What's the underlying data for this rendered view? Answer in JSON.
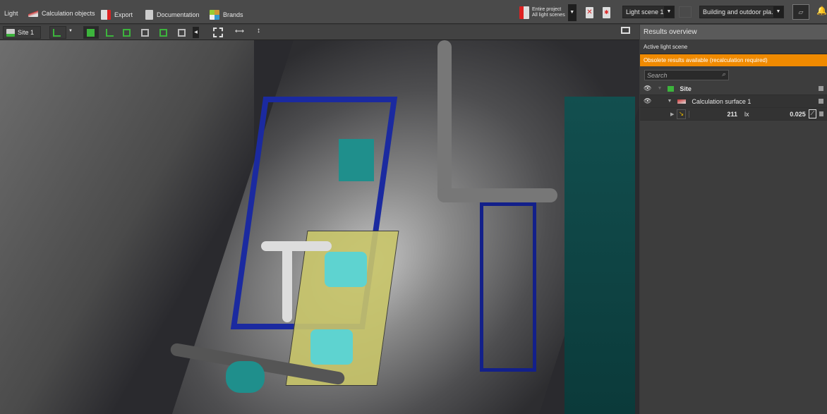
{
  "menu": {
    "light": "Light",
    "calc_objects": "Calculation objects",
    "export": "Export",
    "documentation": "Documentation",
    "brands": "Brands"
  },
  "scope": {
    "line1": "Entire project",
    "line2": "All light scenes"
  },
  "light_scene": "Light scene 1",
  "view_mode": "Building and outdoor pla...",
  "toolbar": {
    "site": "Site 1"
  },
  "results": {
    "title": "Results overview",
    "active_scene": "Active light scene",
    "warning": "Obsolete results available (recalculation required)",
    "search_placeholder": "Search",
    "tree": {
      "site": "Site",
      "surface": "Calculation surface 1",
      "value": "211",
      "unit": "lx",
      "uniformity": "0.025"
    }
  },
  "colors": {
    "warning": "#f08a00",
    "accent": "#3cb43c"
  }
}
